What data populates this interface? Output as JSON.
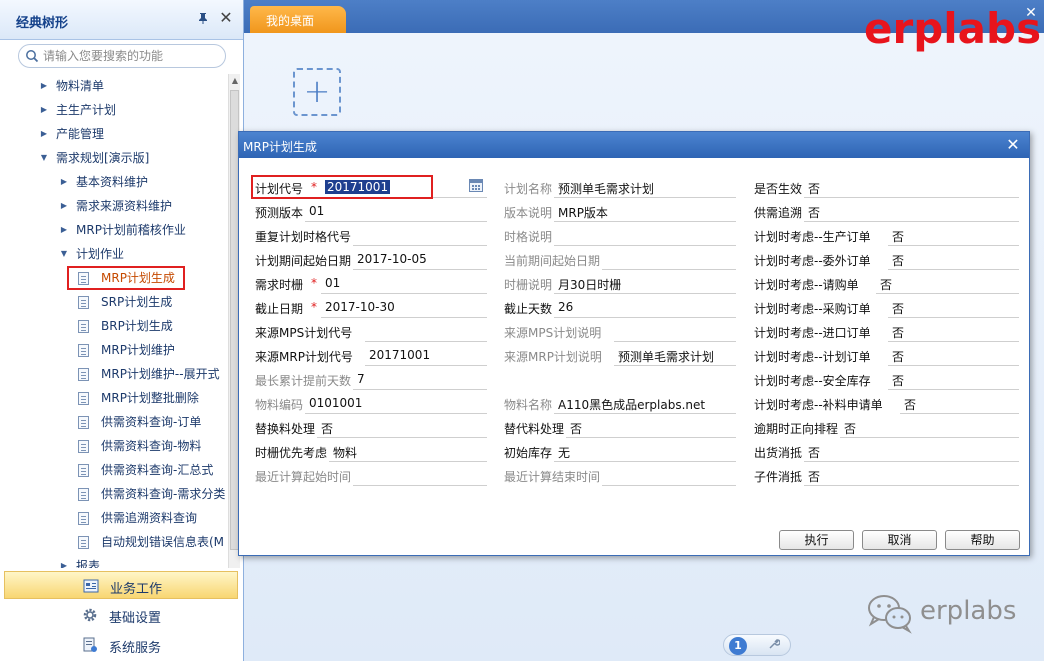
{
  "sidebar": {
    "title": "经典树形",
    "search_placeholder": "请输入您要搜索的功能",
    "tree": [
      {
        "label": "物料清单",
        "level": 0,
        "expanded": false
      },
      {
        "label": "主生产计划",
        "level": 0,
        "expanded": false
      },
      {
        "label": "产能管理",
        "level": 0,
        "expanded": false
      },
      {
        "label": "需求规划[演示版]",
        "level": 0,
        "expanded": true
      },
      {
        "label": "基本资料维护",
        "level": 1,
        "expanded": false
      },
      {
        "label": "需求来源资料维护",
        "level": 1,
        "expanded": false
      },
      {
        "label": "MRP计划前稽核作业",
        "level": 1,
        "expanded": false
      },
      {
        "label": "计划作业",
        "level": 1,
        "expanded": true
      },
      {
        "label": "MRP计划生成",
        "level": 2,
        "selected": true
      },
      {
        "label": "SRP计划生成",
        "level": 2
      },
      {
        "label": "BRP计划生成",
        "level": 2
      },
      {
        "label": "MRP计划维护",
        "level": 2
      },
      {
        "label": "MRP计划维护--展开式",
        "level": 2
      },
      {
        "label": "MRP计划整批删除",
        "level": 2
      },
      {
        "label": "供需资料查询-订单",
        "level": 2
      },
      {
        "label": "供需资料查询-物料",
        "level": 2
      },
      {
        "label": "供需资料查询-汇总式",
        "level": 2
      },
      {
        "label": "供需资料查询-需求分类",
        "level": 2
      },
      {
        "label": "供需追溯资料查询",
        "level": 2
      },
      {
        "label": "自动规划错误信息表(M",
        "level": 2
      },
      {
        "label": "报表",
        "level": 1,
        "expanded": false
      }
    ],
    "bottom_nav": {
      "work": "业务工作",
      "base": "基础设置",
      "system": "系统服务"
    }
  },
  "tabs": {
    "desktop": "我的桌面"
  },
  "brand": {
    "logo": "erplabs",
    "watermark": "erplabs",
    "logo_color": "#e8141c"
  },
  "pager": {
    "current": "1"
  },
  "dialog": {
    "title": "MRP计划生成",
    "col1": [
      {
        "label": "计划代号",
        "value": "20171001",
        "required": true
      },
      {
        "label": "预测版本",
        "value": "01"
      },
      {
        "label": "重复计划时格代号",
        "value": ""
      },
      {
        "label": "计划期间起始日期",
        "value": "2017-10-05"
      },
      {
        "label": "需求时栅",
        "value": "01",
        "required": true
      },
      {
        "label": "截止日期",
        "value": "2017-10-30",
        "required": true
      },
      {
        "label": "来源MPS计划代号",
        "value": ""
      },
      {
        "label": "来源MRP计划代号",
        "value": "20171001"
      },
      {
        "label": "最长累计提前天数",
        "value": "7",
        "disabled": true
      },
      {
        "label": "物料编码",
        "value": "0101001",
        "disabled": true
      },
      {
        "label": "替换料处理",
        "value": "否"
      },
      {
        "label": "时栅优先考虑",
        "value": "物料"
      },
      {
        "label": "最近计算起始时间",
        "value": "",
        "disabled": true
      }
    ],
    "col2": [
      {
        "label": "计划名称",
        "value": "预测单毛需求计划",
        "disabled": true
      },
      {
        "label": "版本说明",
        "value": "MRP版本",
        "disabled": true
      },
      {
        "label": "时格说明",
        "value": "",
        "disabled": true
      },
      {
        "label": "当前期间起始日期",
        "value": "",
        "disabled": true
      },
      {
        "label": "时栅说明",
        "value": "月30日时栅",
        "disabled": true
      },
      {
        "label": "截止天数",
        "value": "26"
      },
      {
        "label": "来源MPS计划说明",
        "value": "",
        "disabled": true
      },
      {
        "label": "来源MRP计划说明",
        "value": "预测单毛需求计划",
        "disabled": true
      },
      {
        "label": "",
        "value": ""
      },
      {
        "label": "物料名称",
        "value": "A110黑色成品erplabs.net",
        "disabled": true
      },
      {
        "label": "替代料处理",
        "value": "否"
      },
      {
        "label": "初始库存",
        "value": "无"
      },
      {
        "label": "最近计算结束时间",
        "value": "",
        "disabled": true
      }
    ],
    "col3": [
      {
        "label": "是否生效",
        "value": "否"
      },
      {
        "label": "供需追溯",
        "value": "否"
      },
      {
        "label": "计划时考虑--生产订单",
        "value": "否"
      },
      {
        "label": "计划时考虑--委外订单",
        "value": "否"
      },
      {
        "label": "计划时考虑--请购单",
        "value": "否"
      },
      {
        "label": "计划时考虑--采购订单",
        "value": "否"
      },
      {
        "label": "计划时考虑--进口订单",
        "value": "否"
      },
      {
        "label": "计划时考虑--计划订单",
        "value": "否"
      },
      {
        "label": "计划时考虑--安全库存",
        "value": "否"
      },
      {
        "label": "计划时考虑--补料申请单",
        "value": "否"
      },
      {
        "label": "逾期时正向排程",
        "value": "否"
      },
      {
        "label": "出货消抵",
        "value": "否"
      },
      {
        "label": "子件消抵",
        "value": "否"
      }
    ],
    "buttons": {
      "execute": "执行",
      "cancel": "取消",
      "help": "帮助"
    }
  }
}
